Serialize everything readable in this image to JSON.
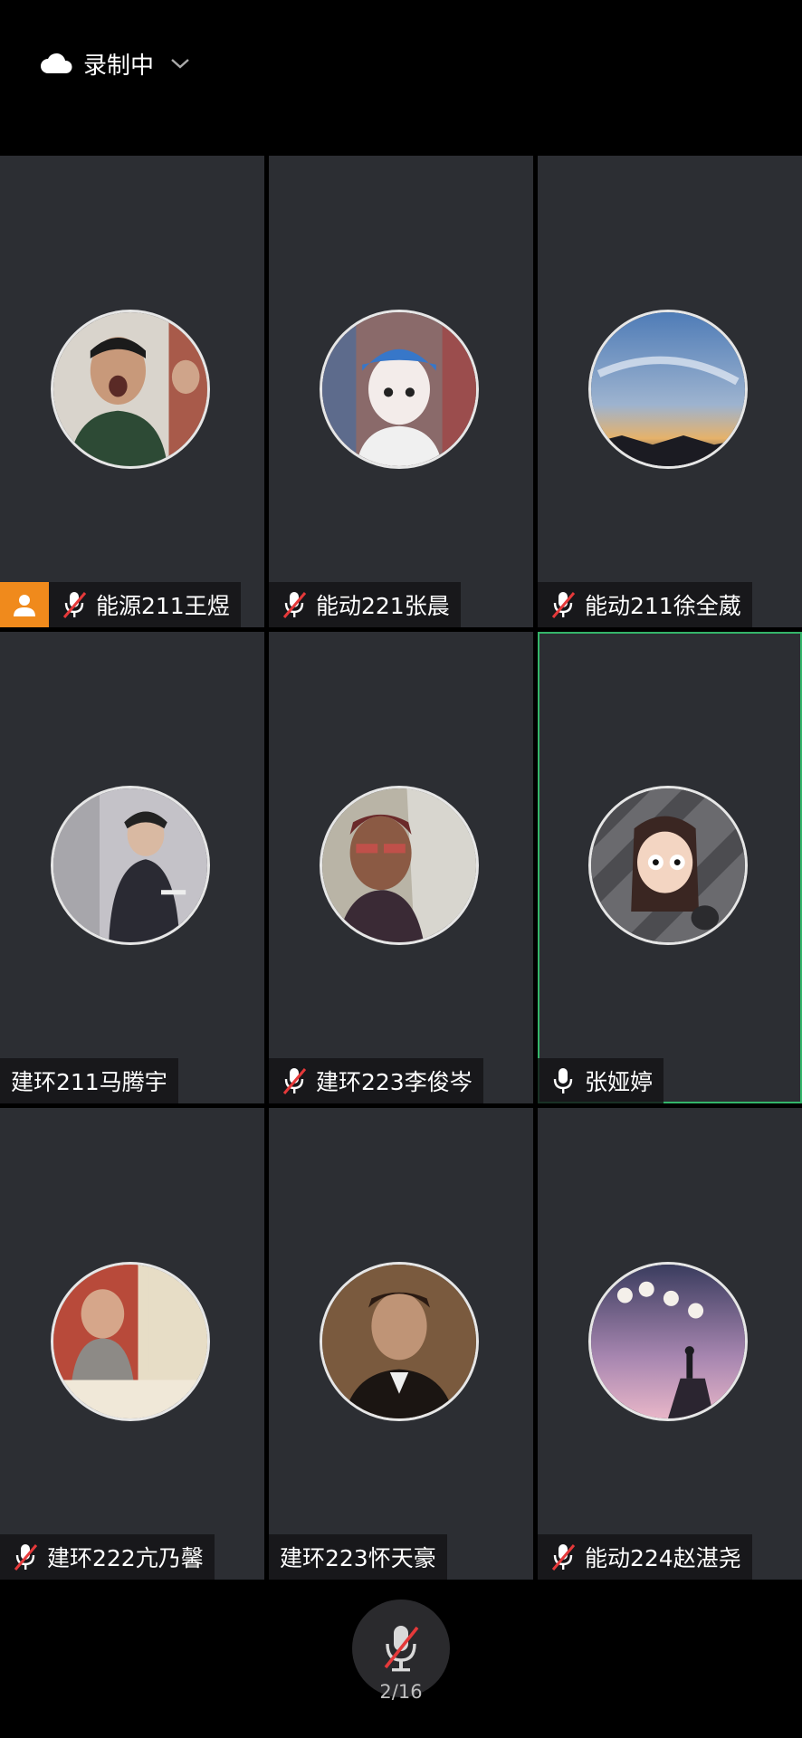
{
  "topbar": {
    "recording_label": "录制中",
    "cloud_icon": "cloud-icon",
    "dropdown_icon": "chevron-down-icon"
  },
  "participants": [
    {
      "name": "能源211王煜",
      "muted": true,
      "host": true,
      "speaking": false
    },
    {
      "name": "能动221张晨",
      "muted": true,
      "host": false,
      "speaking": false
    },
    {
      "name": "能动211徐全葳",
      "muted": true,
      "host": false,
      "speaking": false
    },
    {
      "name": "建环211马腾宇",
      "muted": null,
      "host": false,
      "speaking": false
    },
    {
      "name": "建环223李俊岑",
      "muted": true,
      "host": false,
      "speaking": false
    },
    {
      "name": "张娅婷",
      "muted": false,
      "host": false,
      "speaking": true
    },
    {
      "name": "建环222亢乃馨",
      "muted": true,
      "host": false,
      "speaking": false
    },
    {
      "name": "建环223怀天豪",
      "muted": null,
      "host": false,
      "speaking": false
    },
    {
      "name": "能动224赵湛尧",
      "muted": true,
      "host": false,
      "speaking": false
    }
  ],
  "footer": {
    "mic_button_icon": "mic-muted-icon",
    "page_indicator": "2/16"
  },
  "colors": {
    "tile_bg": "#2c2e33",
    "active_border": "#34b56a",
    "host_badge": "#f08a1c",
    "mute_slash": "#e5393a"
  }
}
